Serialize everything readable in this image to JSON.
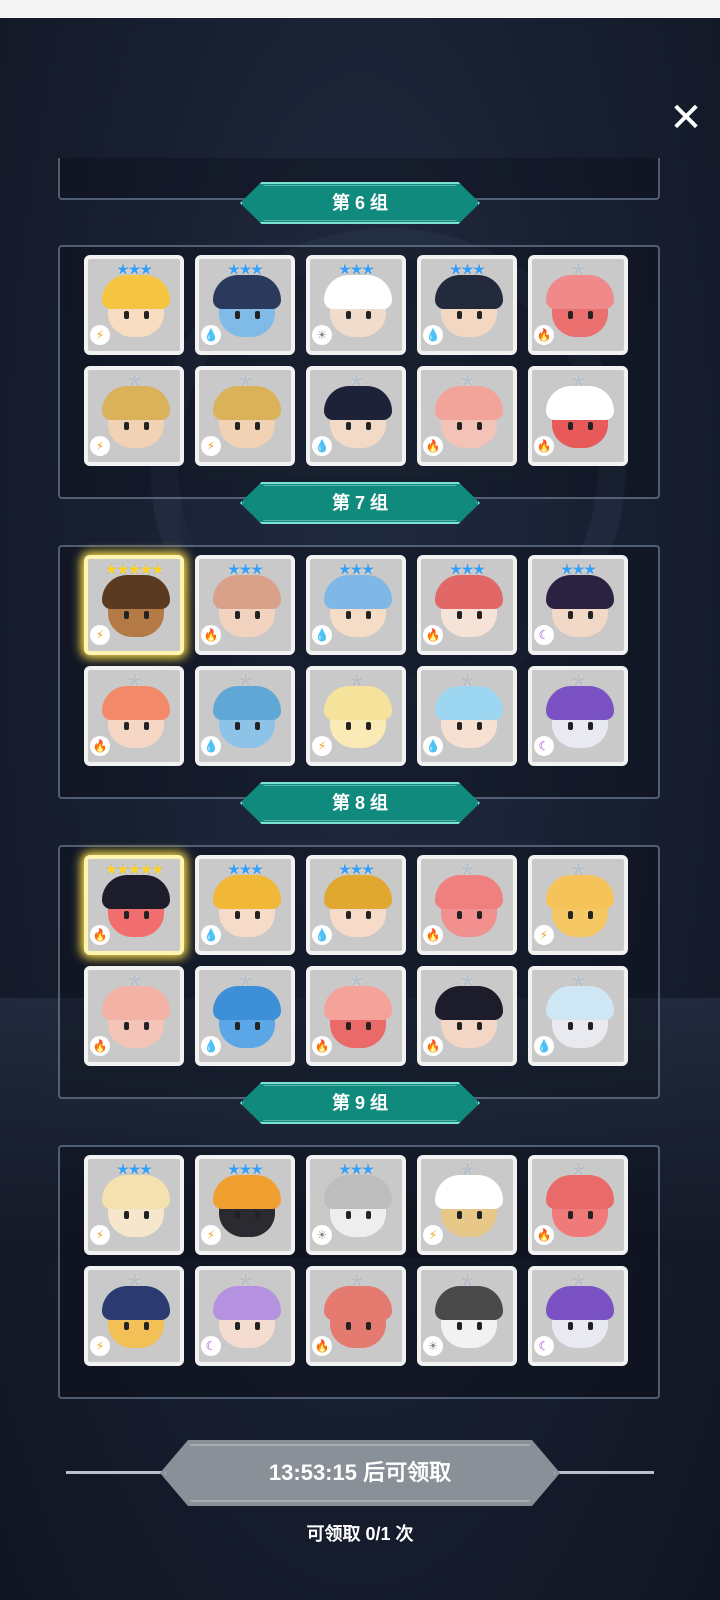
{
  "close_icon": "close-icon",
  "groups": [
    {
      "label": "第 6 组",
      "rows": [
        [
          {
            "stars": 3,
            "elem": "thunder",
            "hair": "#f5c542",
            "face": "#f7dcc2"
          },
          {
            "stars": 3,
            "elem": "water",
            "hair": "#2b3a5c",
            "face": "#7fbbe6"
          },
          {
            "stars": 3,
            "elem": "light",
            "hair": "#ffffff",
            "face": "#f1dccb"
          },
          {
            "stars": 3,
            "elem": "water",
            "hair": "#222a3c",
            "face": "#f4d7c0"
          },
          {
            "stars": 1,
            "elem": "fire",
            "hair": "#f08a8a",
            "face": "#ea6f6f"
          }
        ],
        [
          {
            "stars": 1,
            "elem": "thunder",
            "hair": "#d9b25a",
            "face": "#f1d2b4"
          },
          {
            "stars": 1,
            "elem": "thunder",
            "hair": "#d9b25a",
            "face": "#f1d2b4"
          },
          {
            "stars": 1,
            "elem": "water",
            "hair": "#1d2238",
            "face": "#f3dac6"
          },
          {
            "stars": 1,
            "elem": "fire",
            "hair": "#f2a49a",
            "face": "#f3c3b7"
          },
          {
            "stars": 1,
            "elem": "fire",
            "hair": "#ffffff",
            "face": "#e85a5a"
          }
        ]
      ]
    },
    {
      "label": "第 7 组",
      "rows": [
        [
          {
            "stars": 5,
            "elem": "thunder",
            "hair": "#5a3b22",
            "face": "#b37a45",
            "gold": true
          },
          {
            "stars": 3,
            "elem": "fire",
            "hair": "#d9a08a",
            "face": "#f2d3c0"
          },
          {
            "stars": 3,
            "elem": "water",
            "hair": "#7fb8e6",
            "face": "#f4dcc6"
          },
          {
            "stars": 3,
            "elem": "fire",
            "hair": "#e26767",
            "face": "#f5e3d7"
          },
          {
            "stars": 3,
            "elem": "dark",
            "hair": "#2a2240",
            "face": "#f2d8c6"
          }
        ],
        [
          {
            "stars": 1,
            "elem": "fire",
            "hair": "#f28a6a",
            "face": "#f6d6c4"
          },
          {
            "stars": 1,
            "elem": "water",
            "hair": "#5fa8d6",
            "face": "#8ec3e8"
          },
          {
            "stars": 1,
            "elem": "thunder",
            "hair": "#f6e39b",
            "face": "#f9eab6"
          },
          {
            "stars": 1,
            "elem": "water",
            "hair": "#9dd6f0",
            "face": "#f5e0d2"
          },
          {
            "stars": 1,
            "elem": "dark",
            "hair": "#7b52c4",
            "face": "#e9e9f2"
          }
        ]
      ]
    },
    {
      "label": "第 8 组",
      "rows": [
        [
          {
            "stars": 5,
            "elem": "fire",
            "hair": "#1c1c2a",
            "face": "#f26d6d",
            "gold": true
          },
          {
            "stars": 3,
            "elem": "water",
            "hair": "#f1b838",
            "face": "#f6dcc8"
          },
          {
            "stars": 3,
            "elem": "water",
            "hair": "#e0a830",
            "face": "#f6dcc8"
          },
          {
            "stars": 1,
            "elem": "fire",
            "hair": "#f08080",
            "face": "#f29090"
          },
          {
            "stars": 1,
            "elem": "thunder",
            "hair": "#f6c25a",
            "face": "#f6c864"
          }
        ],
        [
          {
            "stars": 1,
            "elem": "fire",
            "hair": "#f2b2a6",
            "face": "#f4c4b8"
          },
          {
            "stars": 1,
            "elem": "water",
            "hair": "#3d8fd8",
            "face": "#5aa6e6"
          },
          {
            "stars": 1,
            "elem": "fire",
            "hair": "#f4a29a",
            "face": "#ea6a6a"
          },
          {
            "stars": 1,
            "elem": "fire",
            "hair": "#1d1c2a",
            "face": "#f4d6c6"
          },
          {
            "stars": 1,
            "elem": "water",
            "hair": "#cfe6f5",
            "face": "#e8eaf0"
          }
        ]
      ]
    },
    {
      "label": "第 9 组",
      "rows": [
        [
          {
            "stars": 3,
            "elem": "thunder",
            "hair": "#f3e2b0",
            "face": "#f5e6cc"
          },
          {
            "stars": 3,
            "elem": "thunder",
            "hair": "#f0a030",
            "face": "#2a2a30"
          },
          {
            "stars": 3,
            "elem": "light",
            "hair": "#bdbdbd",
            "face": "#eeeeee"
          },
          {
            "stars": 1,
            "elem": "thunder",
            "hair": "#ffffff",
            "face": "#e8c888"
          },
          {
            "stars": 1,
            "elem": "fire",
            "hair": "#ea6a6a",
            "face": "#f07a7a"
          }
        ],
        [
          {
            "stars": 1,
            "elem": "thunder",
            "hair": "#2b3a70",
            "face": "#f2c056"
          },
          {
            "stars": 1,
            "elem": "dark",
            "hair": "#b592e0",
            "face": "#f5dcd0"
          },
          {
            "stars": 1,
            "elem": "fire",
            "hair": "#e47a70",
            "face": "#e47a70"
          },
          {
            "stars": 1,
            "elem": "light",
            "hair": "#4a4a4a",
            "face": "#f2f2f2"
          },
          {
            "stars": 1,
            "elem": "dark",
            "hair": "#7b52c4",
            "face": "#e9e9f2"
          }
        ]
      ]
    }
  ],
  "element_glyphs": {
    "fire": "🔥",
    "water": "💧",
    "thunder": "⚡",
    "light": "☀",
    "dark": "☾"
  },
  "element_colors": {
    "fire": "#e84a2a",
    "water": "#2a7fe0",
    "thunder": "#f0a020",
    "light": "#888888",
    "dark": "#a040d0"
  },
  "colors": {
    "banner": "#0f8a7c",
    "gold_glow": "#ffe14a",
    "timer_bg": "#8a9098"
  },
  "footer": {
    "timer_label": "13:53:15 后可领取",
    "claim_count": "可领取 0/1 次"
  }
}
